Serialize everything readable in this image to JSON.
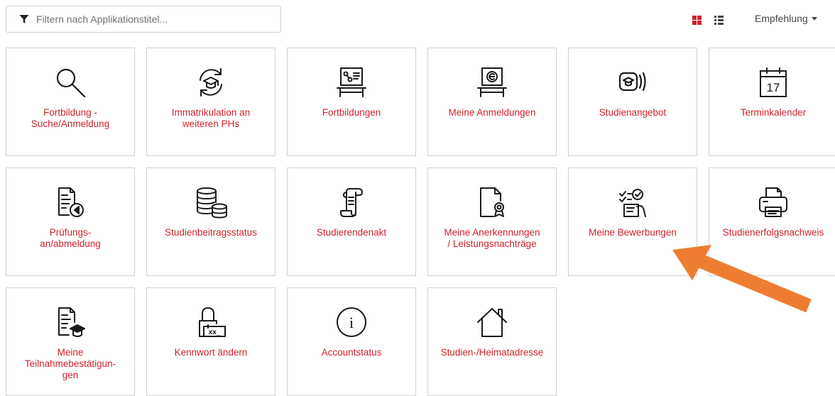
{
  "filter": {
    "placeholder": "Filtern nach Applikationstitel...",
    "icon": "filter-icon"
  },
  "view_toggle": {
    "grid_icon": "grid-view-icon",
    "list_icon": "list-view-icon",
    "active": "grid"
  },
  "sort": {
    "label": "Empfehlung"
  },
  "tiles": [
    {
      "label": "Fortbildung -\nSuche/Anmeldung",
      "icon": "search-icon"
    },
    {
      "label": "Immatrikulation an\nweiteren PHs",
      "icon": "graduation-cap-refresh-icon"
    },
    {
      "label": "Fortbildungen",
      "icon": "presentation-board-icon"
    },
    {
      "label": "Meine Anmeldungen",
      "icon": "registration-board-icon"
    },
    {
      "label": "Studienangebot",
      "icon": "course-offer-icon"
    },
    {
      "label": "Terminkalender",
      "icon": "calendar-icon",
      "calendar_day": "17"
    },
    {
      "label": "Prüfungs-\nan/abmeldung",
      "icon": "exam-registration-icon"
    },
    {
      "label": "Studienbeitragsstatus",
      "icon": "coin-stack-icon"
    },
    {
      "label": "Studierendenakt",
      "icon": "scroll-icon"
    },
    {
      "label": "Meine Anerkennungen\n/ Leistungsnachträge",
      "icon": "certificate-document-icon"
    },
    {
      "label": "Meine Bewerbungen",
      "icon": "application-checklist-icon"
    },
    {
      "label": "Studienerfolgsnachweis",
      "icon": "printer-icon"
    },
    {
      "label": "Meine\nTeilnahmebestätigun-\ngen",
      "icon": "participation-certificate-icon"
    },
    {
      "label": "Kennwort ändern",
      "icon": "password-lock-icon",
      "password_mask": "xx_"
    },
    {
      "label": "Accountstatus",
      "icon": "info-icon",
      "info_glyph": "i"
    },
    {
      "label": "Studien-/Heimatadresse",
      "icon": "house-icon"
    }
  ],
  "colors": {
    "accent": "#d0212b",
    "arrow": "#ee7d31",
    "border": "#d0d0d0",
    "icon": "#1a1a1a"
  }
}
